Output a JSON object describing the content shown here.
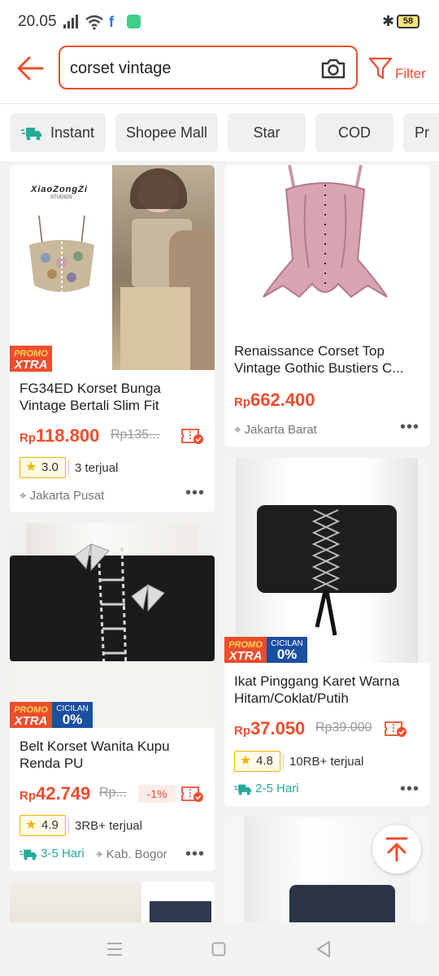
{
  "status": {
    "time": "20.05",
    "battery": "58"
  },
  "search": {
    "query": "corset vintage",
    "filter_label": "Filter"
  },
  "chips": [
    "Instant",
    "Shopee Mall",
    "Star",
    "COD",
    "Pr"
  ],
  "badges": {
    "promo_top": "PROMO",
    "promo_bottom": "XTRA",
    "cicilan_top": "CICILAN",
    "cicilan_bottom": "0%"
  },
  "products": [
    {
      "title": "FG34ED Korset Bunga Vintage Bertali Slim Fit",
      "currency": "Rp",
      "price": "118.800",
      "old_price": "Rp135...",
      "rating": "3.0",
      "sold": "3 terjual",
      "location": "Jakarta Pusat",
      "image_text_brand": "XiaoZongZi",
      "image_text_sub": "STUDIOS"
    },
    {
      "title": "Renaissance Corset Top Vintage Gothic Bustiers C...",
      "currency": "Rp",
      "price": "662.400",
      "location": "Jakarta Barat"
    },
    {
      "title": "Ikat Pinggang Karet Warna Hitam/Coklat/Putih",
      "currency": "Rp",
      "price": "37.050",
      "old_price": "Rp39.000",
      "rating": "4.8",
      "sold": "10RB+ terjual",
      "delivery": "2-5 Hari"
    },
    {
      "title": "Belt Korset Wanita Kupu Renda PU",
      "currency": "Rp",
      "price": "42.749",
      "old_price": "Rp...",
      "discount": "-1%",
      "rating": "4.9",
      "sold": "3RB+ terjual",
      "delivery": "3-5 Hari",
      "location": "Kab. Bogor"
    }
  ],
  "colors": {
    "brand": "#ee4d2d",
    "rating": "#f4b400",
    "delivery": "#26aa99"
  }
}
